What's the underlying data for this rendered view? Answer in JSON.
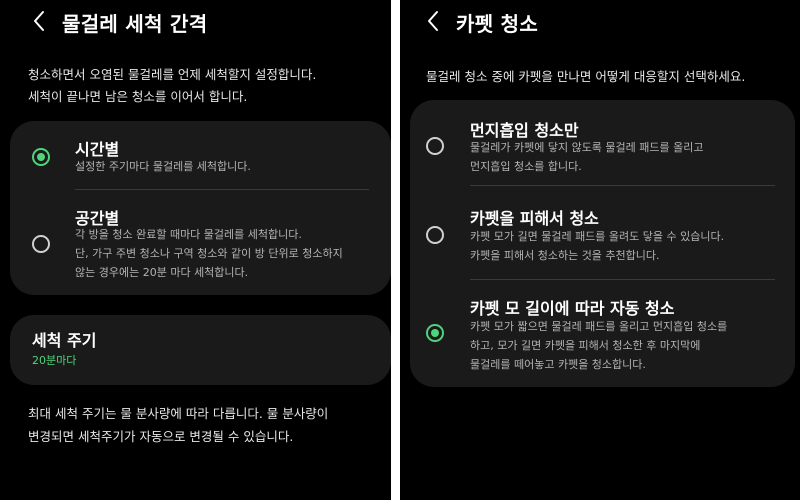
{
  "left": {
    "title": "물걸레 세척 간격",
    "description": [
      "청소하면서 오염된 물걸레를 언제 세척할지 설정합니다.",
      "세척이 끝나면 남은 청소를 이어서 합니다."
    ],
    "options": [
      {
        "title": "시간별",
        "subtitle": [
          "설정한 주기마다 물걸레를 세척합니다."
        ],
        "selected": true
      },
      {
        "title": "공간별",
        "subtitle": [
          "각 방을 청소 완료할 때마다 물걸레를 세척합니다.",
          "단, 가구 주변 청소나 구역 청소와 같이 방 단위로 청소하지",
          "않는 경우에는 20분 마다 세척합니다."
        ],
        "selected": false
      }
    ],
    "frequency": {
      "title": "세척 주기",
      "value": "20분마다"
    },
    "footnote": [
      "최대 세척 주기는 물 분사량에 따라 다릅니다. 물 분사량이",
      "변경되면 세척주기가 자동으로 변경될 수 있습니다."
    ]
  },
  "right": {
    "title": "카펫 청소",
    "description": [
      "물걸레 청소 중에 카펫을 만나면 어떻게 대응할지 선택하세요."
    ],
    "options": [
      {
        "title": "먼지흡입 청소만",
        "subtitle": [
          "물걸레가 카펫에 닿지 않도록 물걸레 패드를 올리고",
          "먼지흡입 청소를 합니다."
        ],
        "selected": false
      },
      {
        "title": "카펫을 피해서 청소",
        "subtitle": [
          "카펫 모가 길면 물걸레 패드를 올려도 닿을 수 있습니다.",
          "카펫을 피해서 청소하는 것을 추천합니다."
        ],
        "selected": false
      },
      {
        "title": "카펫 모 길이에 따라 자동 청소",
        "subtitle": [
          "카펫 모가 짧으면 물걸레 패드를 올리고 먼지흡입 청소를",
          "하고, 모가 길면 카펫을 피해서 청소한 후 마지막에",
          "물걸레를 떼어놓고 카펫을 청소합니다."
        ],
        "selected": true
      }
    ]
  },
  "icons": {
    "back": "chevron-left-icon",
    "selected_radio": "radio-selected-icon",
    "unselected_radio": "radio-unselected-icon"
  },
  "colors": {
    "accent": "#4fd37b",
    "background": "#000000",
    "card": "#1a1a1a",
    "subtext": "#b4b4b4"
  }
}
